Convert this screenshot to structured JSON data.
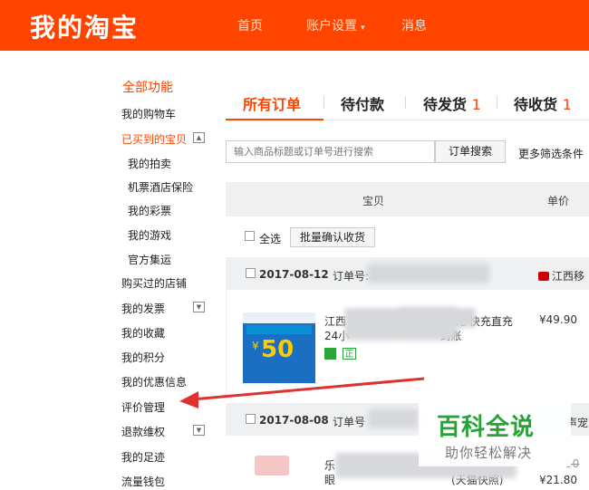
{
  "header": {
    "logo": "我的淘宝",
    "nav": {
      "home": "首页",
      "account": "账户设置",
      "messages": "消息"
    }
  },
  "sidebar": {
    "all_functions": "全部功能",
    "cart": "我的购物车",
    "bought": "已买到的宝贝",
    "auction": "我的拍卖",
    "tickets": "机票酒店保险",
    "lottery": "我的彩票",
    "games": "我的游戏",
    "official": "官方集运",
    "stores": "购买过的店铺",
    "invoice": "我的发票",
    "favorites": "我的收藏",
    "points": "我的积分",
    "coupons": "我的优惠信息",
    "reviews": "评价管理",
    "refunds": "退款维权",
    "footprints": "我的足迹",
    "wallet": "流量钱包"
  },
  "tabs": {
    "all": "所有订单",
    "pending_pay": "待付款",
    "pending_ship": "待发货",
    "pending_ship_count": "1",
    "pending_receive": "待收货",
    "pending_receive_count": "1"
  },
  "search": {
    "placeholder": "输入商品标题或订单号进行搜索",
    "button": "订单搜索",
    "more_filters": "更多筛选条件"
  },
  "table": {
    "col_item": "宝贝",
    "col_price": "单价",
    "select_all": "全选",
    "bulk_confirm": "批量确认收货"
  },
  "orders": [
    {
      "date": "2017-08-12",
      "number_label": "订单号:",
      "shop": "江西移",
      "title_start": "江西",
      "title_end": "元 快充直充",
      "line2_start": "24小",
      "line2_end": "到账",
      "badge": "正",
      "price": "¥49.90",
      "thumb_value": "50",
      "thumb_yen": "¥"
    },
    {
      "date": "2017-08-08",
      "number_label": "订单号",
      "shop": "声宠",
      "title_start": "乐",
      "line2_start": "眼",
      "line2_end": "(天猫快照)",
      "price_old": "50",
      "price": "¥21.80"
    }
  ],
  "watermark": {
    "main": "百科全说",
    "sub": "助你轻松解决"
  },
  "colors": {
    "brand": "#ff4400",
    "annotation_arrow": "#e03030",
    "watermark": "#27a336"
  }
}
